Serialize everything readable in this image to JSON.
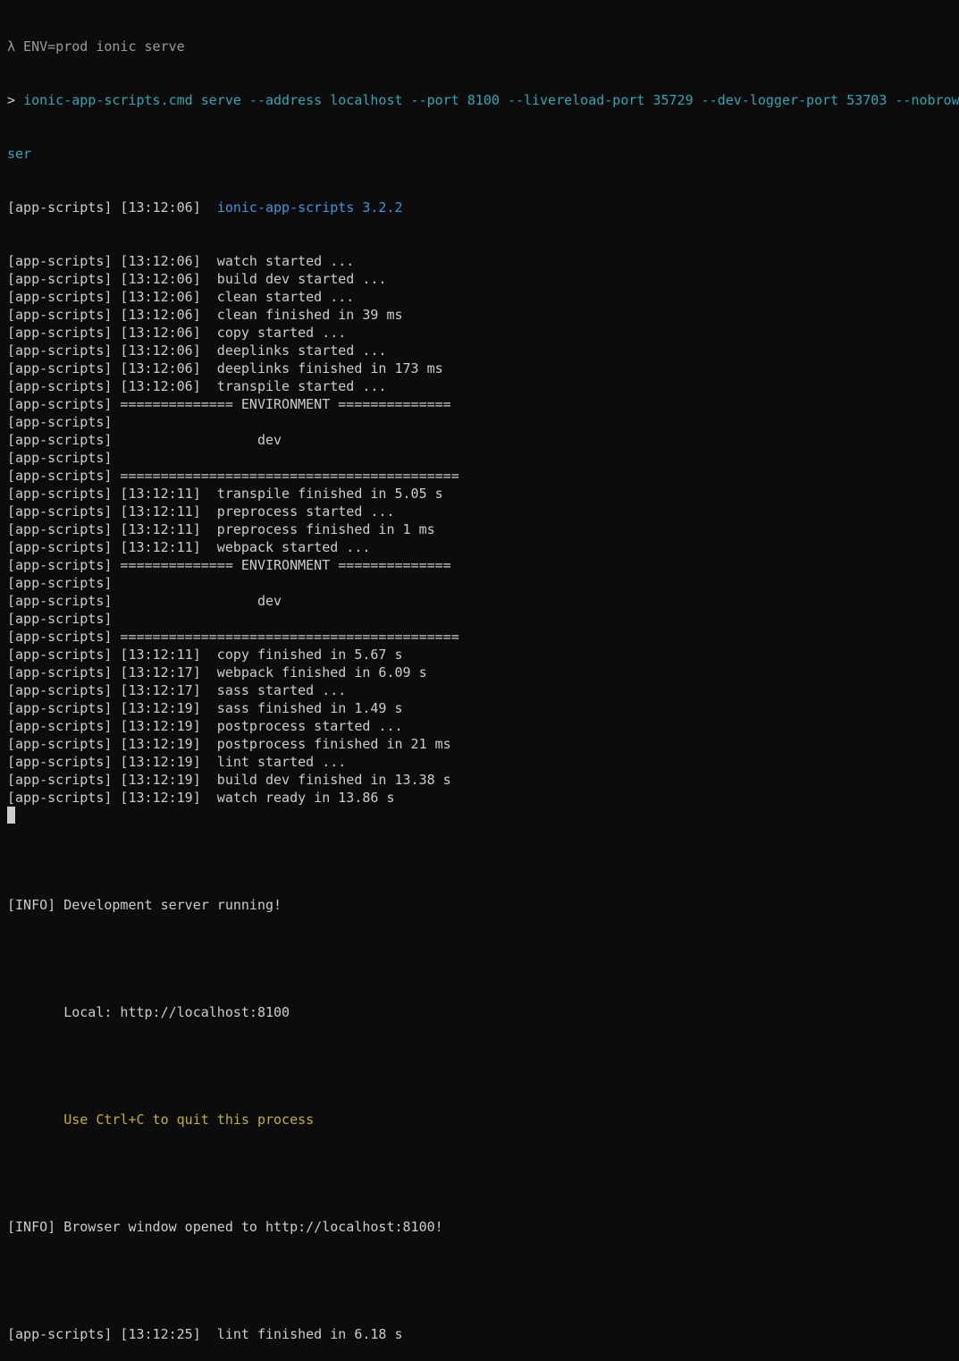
{
  "colors": {
    "background": "#0c0c0c",
    "text": "#cccccc",
    "command": "#2aa7b5",
    "version": "#3a96dd",
    "highlight": "#c1b02f"
  },
  "terminal": {
    "prompt_line": "λ ENV=prod ionic serve",
    "command_line_prefix": "> ",
    "command_line": "ionic-app-scripts.cmd serve --address localhost --port 8100 --livereload-port 35729 --dev-logger-port 53703 --nobrow",
    "command_line_wrap": "ser",
    "version_prefix": "[app-scripts] [13:12:06]  ",
    "version_text": "ionic-app-scripts 3.2.2",
    "log_lines_a": [
      "[app-scripts] [13:12:06]  watch started ...",
      "[app-scripts] [13:12:06]  build dev started ...",
      "[app-scripts] [13:12:06]  clean started ...",
      "[app-scripts] [13:12:06]  clean finished in 39 ms",
      "[app-scripts] [13:12:06]  copy started ...",
      "[app-scripts] [13:12:06]  deeplinks started ...",
      "[app-scripts] [13:12:06]  deeplinks finished in 173 ms",
      "[app-scripts] [13:12:06]  transpile started ...",
      "[app-scripts] ============== ENVIRONMENT ==============",
      "[app-scripts]",
      "[app-scripts]                  dev",
      "[app-scripts]",
      "[app-scripts] ==========================================",
      "[app-scripts] [13:12:11]  transpile finished in 5.05 s",
      "[app-scripts] [13:12:11]  preprocess started ...",
      "[app-scripts] [13:12:11]  preprocess finished in 1 ms",
      "[app-scripts] [13:12:11]  webpack started ...",
      "[app-scripts] ============== ENVIRONMENT ==============",
      "[app-scripts]",
      "[app-scripts]                  dev",
      "[app-scripts]",
      "[app-scripts] ==========================================",
      "[app-scripts] [13:12:11]  copy finished in 5.67 s",
      "[app-scripts] [13:12:17]  webpack finished in 6.09 s",
      "[app-scripts] [13:12:17]  sass started ...",
      "[app-scripts] [13:12:19]  sass finished in 1.49 s",
      "[app-scripts] [13:12:19]  postprocess started ...",
      "[app-scripts] [13:12:19]  postprocess finished in 21 ms",
      "[app-scripts] [13:12:19]  lint started ...",
      "[app-scripts] [13:12:19]  build dev finished in 13.38 s",
      "[app-scripts] [13:12:19]  watch ready in 13.86 s"
    ],
    "info_running": "[INFO] Development server running!",
    "local_line": "       Local: http://localhost:8100",
    "quit_line": "       Use Ctrl+C to quit this process",
    "info_browser": "[INFO] Browser window opened to http://localhost:8100!",
    "lint_finished": "[app-scripts] [13:12:25]  lint finished in 6.18 s"
  }
}
